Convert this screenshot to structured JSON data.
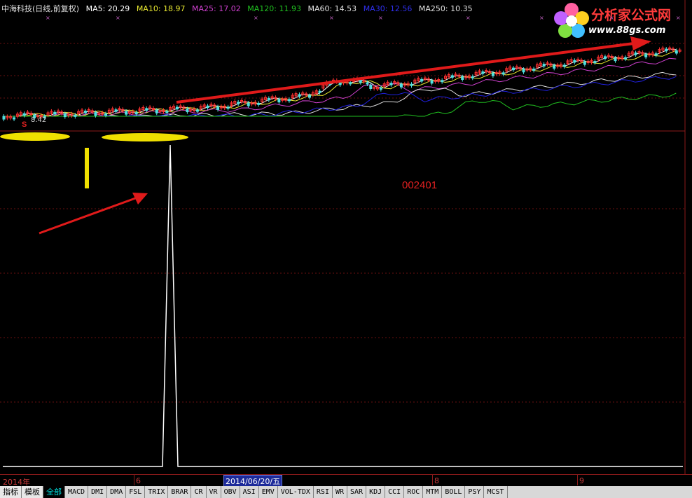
{
  "legend": {
    "title": "中海科技(日线,前复权)",
    "ma5": "MA5: 20.29",
    "ma10": "MA10: 18.97",
    "ma25": "MA25: 17.02",
    "ma120": "MA120: 11.93",
    "ma60": "MA60: 14.53",
    "ma30": "MA30: 12.56",
    "ma250": "MA250: 10.35"
  },
  "colors": {
    "ma5": "#ffffff",
    "ma10": "#e8e830",
    "ma25": "#d040d0",
    "ma120": "#20c020",
    "ma60": "#e0e0e0",
    "ma30": "#2020e0",
    "ma250": "#e0e0e0",
    "up": "#ff3030",
    "down": "#50e0e0",
    "arrow": "#e01a1a",
    "highlight": "#f0e000",
    "grid": "#8b1a1a"
  },
  "chart": {
    "low_price_label": "8.42",
    "signal_marker": "S",
    "stock_code": "002401"
  },
  "axis": {
    "year_label": "2014年",
    "month_6": "6",
    "selected_date": "2014/06/20/五",
    "month_8": "8",
    "month_9": "9"
  },
  "tabs": {
    "mode_indicator": "指标",
    "mode_template": "模板",
    "all": "全部",
    "items": [
      "MACD",
      "DMI",
      "DMA",
      "FSL",
      "TRIX",
      "BRAR",
      "CR",
      "VR",
      "OBV",
      "ASI",
      "EMV",
      "VOL-TDX",
      "RSI",
      "WR",
      "SAR",
      "KDJ",
      "CCI",
      "ROC",
      "MTM",
      "BOLL",
      "PSY",
      "MCST"
    ]
  },
  "logo": {
    "name": "分析家公式网",
    "url": "www.88gs.com"
  },
  "icons": {
    "logo_flower": "flower-icon"
  }
}
